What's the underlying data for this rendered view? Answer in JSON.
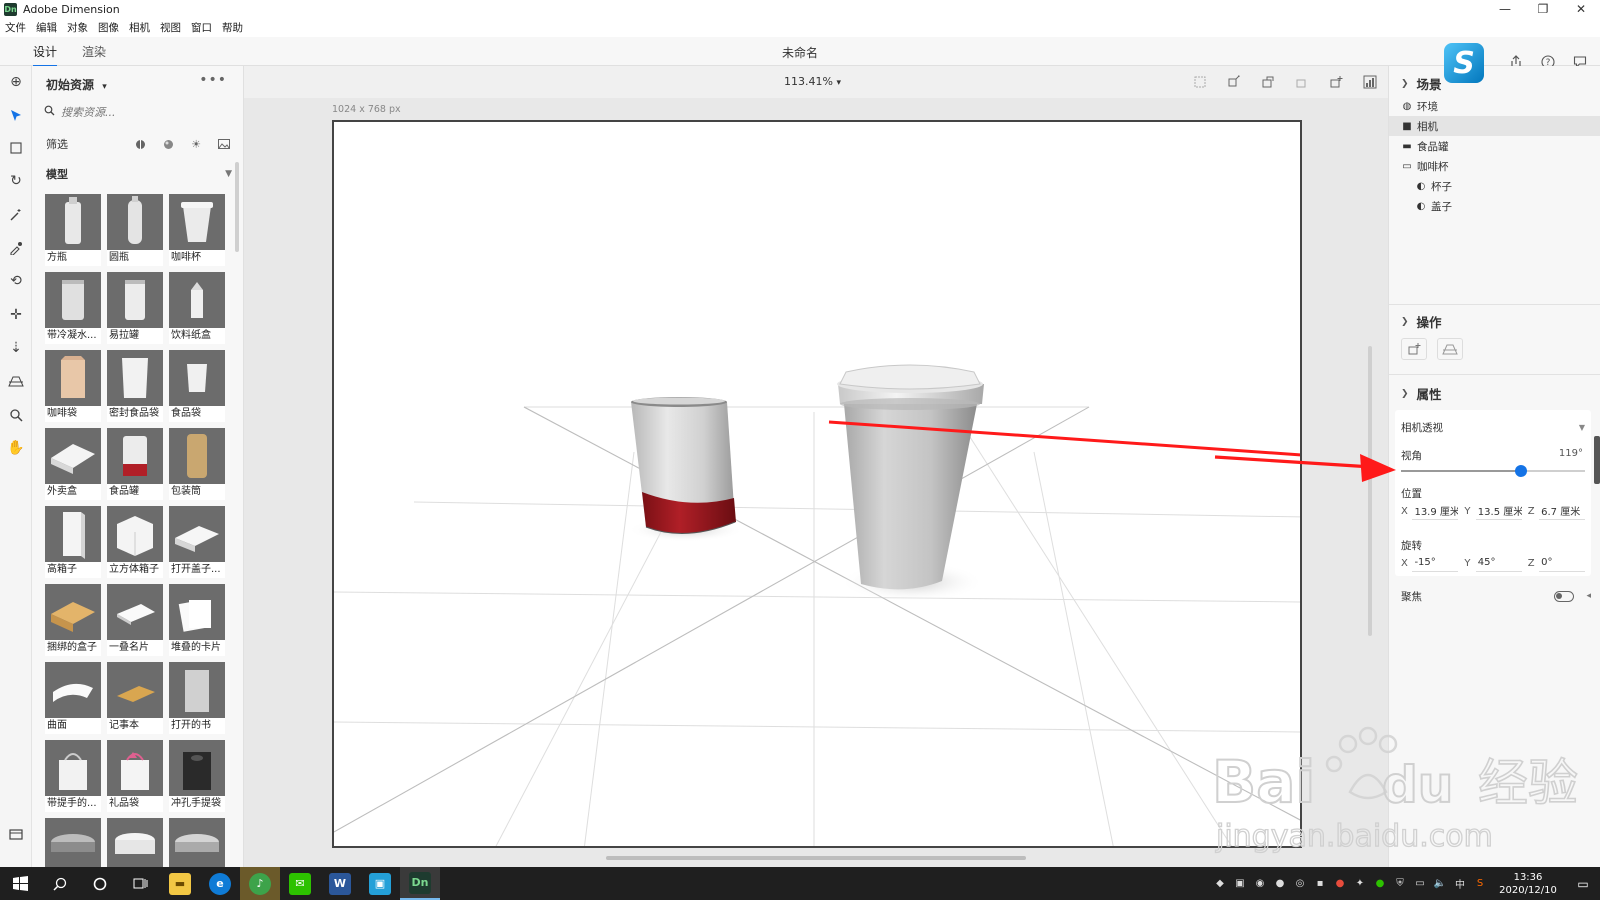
{
  "window": {
    "title": "Adobe Dimension",
    "app_badge": "Dn",
    "controls": [
      "—",
      "❐",
      "✕"
    ]
  },
  "menu": [
    "文件",
    "编辑",
    "对象",
    "图像",
    "相机",
    "视图",
    "窗口",
    "帮助"
  ],
  "modes": {
    "design": "设计",
    "render": "渲染"
  },
  "document": {
    "title": "未命名",
    "canvas_size": "1024 x 768 px",
    "zoom": "113.41%"
  },
  "top_icons": [
    "share-icon",
    "help-icon",
    "chat-icon"
  ],
  "assets_panel": {
    "title": "初始资源",
    "search_placeholder": "搜索资源...",
    "filter_label": "筛选",
    "section_label": "模型",
    "items": [
      {
        "label": "方瓶",
        "shape": "bottle-square"
      },
      {
        "label": "圆瓶",
        "shape": "bottle-round"
      },
      {
        "label": "咖啡杯",
        "shape": "coffee-cup"
      },
      {
        "label": "带冷凝水...",
        "shape": "can-wet"
      },
      {
        "label": "易拉罐",
        "shape": "can"
      },
      {
        "label": "饮料纸盒",
        "shape": "carton"
      },
      {
        "label": "咖啡袋",
        "shape": "bag-coffee"
      },
      {
        "label": "密封食品袋",
        "shape": "pouch"
      },
      {
        "label": "食品袋",
        "shape": "snack-bag"
      },
      {
        "label": "外卖盒",
        "shape": "takeout-box"
      },
      {
        "label": "食品罐",
        "shape": "food-can"
      },
      {
        "label": "包装筒",
        "shape": "tube"
      },
      {
        "label": "高箱子",
        "shape": "tall-box"
      },
      {
        "label": "立方体箱子",
        "shape": "cube-box"
      },
      {
        "label": "打开盖子...",
        "shape": "open-box"
      },
      {
        "label": "捆绑的盒子",
        "shape": "tied-box"
      },
      {
        "label": "一叠名片",
        "shape": "cards"
      },
      {
        "label": "堆叠的卡片",
        "shape": "stacked-cards"
      },
      {
        "label": "曲面",
        "shape": "curved-plane"
      },
      {
        "label": "记事本",
        "shape": "notebook"
      },
      {
        "label": "打开的书",
        "shape": "open-book"
      },
      {
        "label": "带提手的...",
        "shape": "handle-bag"
      },
      {
        "label": "礼品袋",
        "shape": "gift-bag"
      },
      {
        "label": "冲孔手提袋",
        "shape": "punched-bag"
      },
      {
        "label": "",
        "shape": "lid-1"
      },
      {
        "label": "",
        "shape": "lid-2"
      },
      {
        "label": "",
        "shape": "lid-3"
      }
    ]
  },
  "scene_panel": {
    "title": "场景",
    "items": [
      {
        "label": "环境",
        "icon": "globe-icon",
        "indent": 0,
        "selected": false
      },
      {
        "label": "相机",
        "icon": "camera-icon",
        "indent": 0,
        "selected": true
      },
      {
        "label": "食品罐",
        "icon": "folder-icon",
        "indent": 0,
        "selected": false
      },
      {
        "label": "咖啡杯",
        "icon": "folder-open-icon",
        "indent": 0,
        "selected": false
      },
      {
        "label": "杯子",
        "icon": "model-icon",
        "indent": 1,
        "selected": false
      },
      {
        "label": "盖子",
        "icon": "model-icon",
        "indent": 1,
        "selected": false
      }
    ]
  },
  "actions_panel": {
    "title": "操作"
  },
  "properties_panel": {
    "title": "属性",
    "camera_mode": "相机透视",
    "fov_label": "视角",
    "fov_value": "119°",
    "fov_level": 0.65,
    "position_label": "位置",
    "position": {
      "x": "13.9 厘米",
      "y": "13.5 厘米",
      "z": "6.7 厘米"
    },
    "rotation_label": "旋转",
    "rotation": {
      "x": "-15°",
      "y": "45°",
      "z": "0°"
    },
    "focus_label": "聚焦",
    "axis": {
      "x": "X",
      "y": "Y",
      "z": "Z"
    }
  },
  "taskbar": {
    "apps": [
      "start",
      "search",
      "cortana",
      "task-view",
      "explorer",
      "browser",
      "music",
      "wechat",
      "word",
      "ide",
      "dimension"
    ],
    "active_app": "Dn",
    "time": "13:36",
    "date": "2020/12/10",
    "ime": "中"
  },
  "watermark": {
    "brand": "Bai",
    "brand2": "du",
    "cn": "经验",
    "url": "jingyan.baidu.com"
  },
  "colors": {
    "accent": "#1473e6",
    "annotation_arrow": "#ff1a1a",
    "taskbar": "#1f1f1f"
  }
}
